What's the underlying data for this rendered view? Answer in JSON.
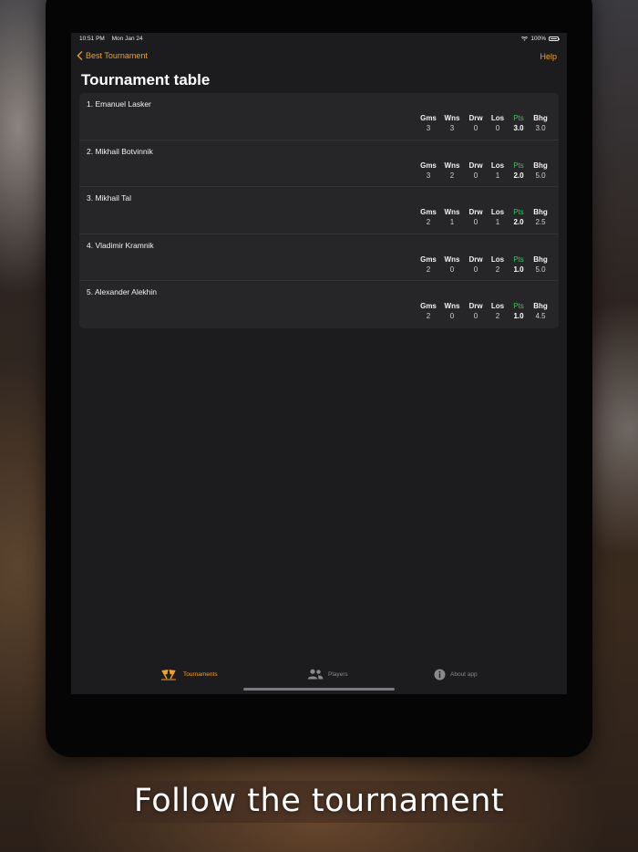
{
  "status_bar": {
    "time": "10:51 PM",
    "date": "Mon Jan 24",
    "battery": "100%"
  },
  "nav": {
    "back_label": "Best Tournament",
    "help_label": "Help"
  },
  "page_title": "Tournament table",
  "columns": {
    "gms": "Gms",
    "wns": "Wns",
    "drw": "Drw",
    "los": "Los",
    "pts": "Pts",
    "bhg": "Bhg"
  },
  "players": [
    {
      "name": "1. Emanuel Lasker",
      "gms": "3",
      "wns": "3",
      "drw": "0",
      "los": "0",
      "pts": "3.0",
      "bhg": "3.0"
    },
    {
      "name": "2. Mikhail Botvinnik",
      "gms": "3",
      "wns": "2",
      "drw": "0",
      "los": "1",
      "pts": "2.0",
      "bhg": "5.0"
    },
    {
      "name": "3. Mikhail Tal",
      "gms": "2",
      "wns": "1",
      "drw": "0",
      "los": "1",
      "pts": "2.0",
      "bhg": "2.5"
    },
    {
      "name": "4. Vladimir Kramnik",
      "gms": "2",
      "wns": "0",
      "drw": "0",
      "los": "2",
      "pts": "1.0",
      "bhg": "5.0"
    },
    {
      "name": "5. Alexander Alekhin",
      "gms": "2",
      "wns": "0",
      "drw": "0",
      "los": "2",
      "pts": "1.0",
      "bhg": "4.5"
    }
  ],
  "tabs": [
    {
      "label": "Tournaments",
      "icon": "flags-icon",
      "active": true
    },
    {
      "label": "Players",
      "icon": "people-icon",
      "active": false
    },
    {
      "label": "About app",
      "icon": "info-icon",
      "active": false
    }
  ],
  "caption": "Follow the tournament",
  "colors": {
    "accent": "#f0a12c",
    "points": "#34c759",
    "background": "#1c1c1e",
    "card": "#262628"
  }
}
